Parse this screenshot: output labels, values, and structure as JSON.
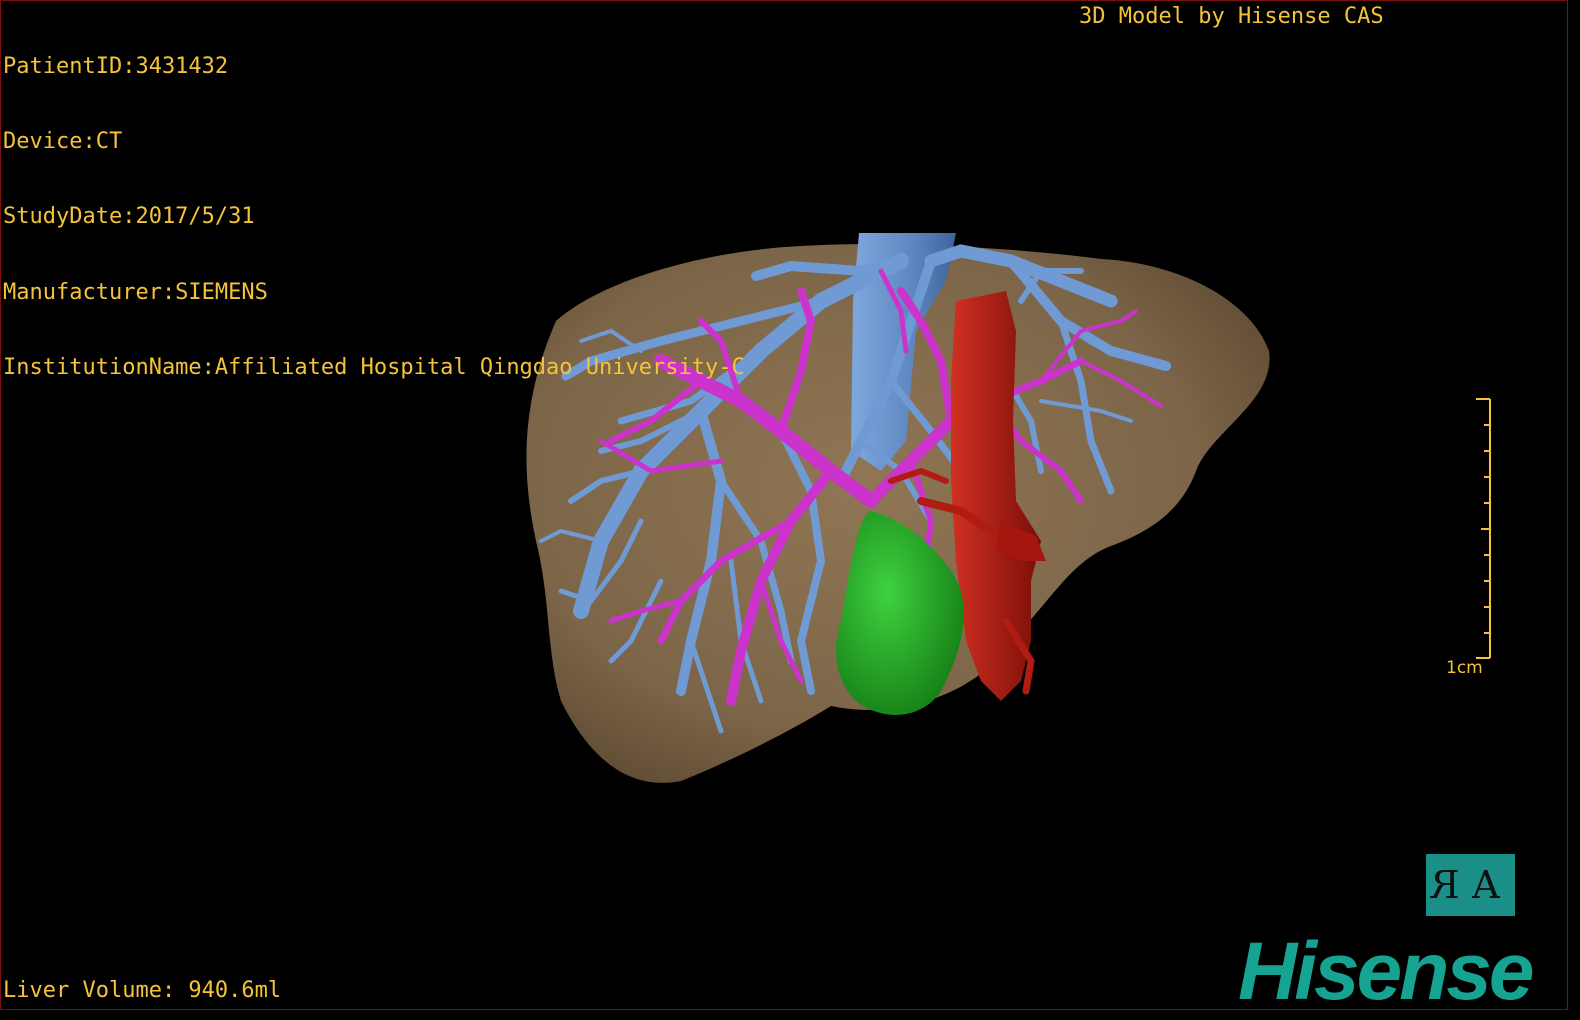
{
  "overlay": {
    "patient_id": "PatientID:3431432",
    "device": "Device:CT",
    "study_date": "StudyDate:2017/5/31",
    "manufacturer": "Manufacturer:SIEMENS",
    "institution": "InstitutionName:Affiliated Hospital Qingdao University-C",
    "model_credit": "3D Model by Hisense CAS",
    "liver_volume": "Liver Volume: 940.6ml",
    "scale_label": "1cm"
  },
  "controls": {
    "orientation_button": {
      "left_glyph": "R",
      "right_glyph": "A"
    }
  },
  "brand": {
    "logo_text": "Hisense",
    "logo_color": "#17a392"
  },
  "colors": {
    "overlay_text": "#f4c33a",
    "liver": "#8a7152",
    "hepatic_vein": "#6f9ad4",
    "portal_vein": "#cc33cc",
    "artery_ivc": "#b01b12",
    "tumor": "#1f9f1f"
  }
}
